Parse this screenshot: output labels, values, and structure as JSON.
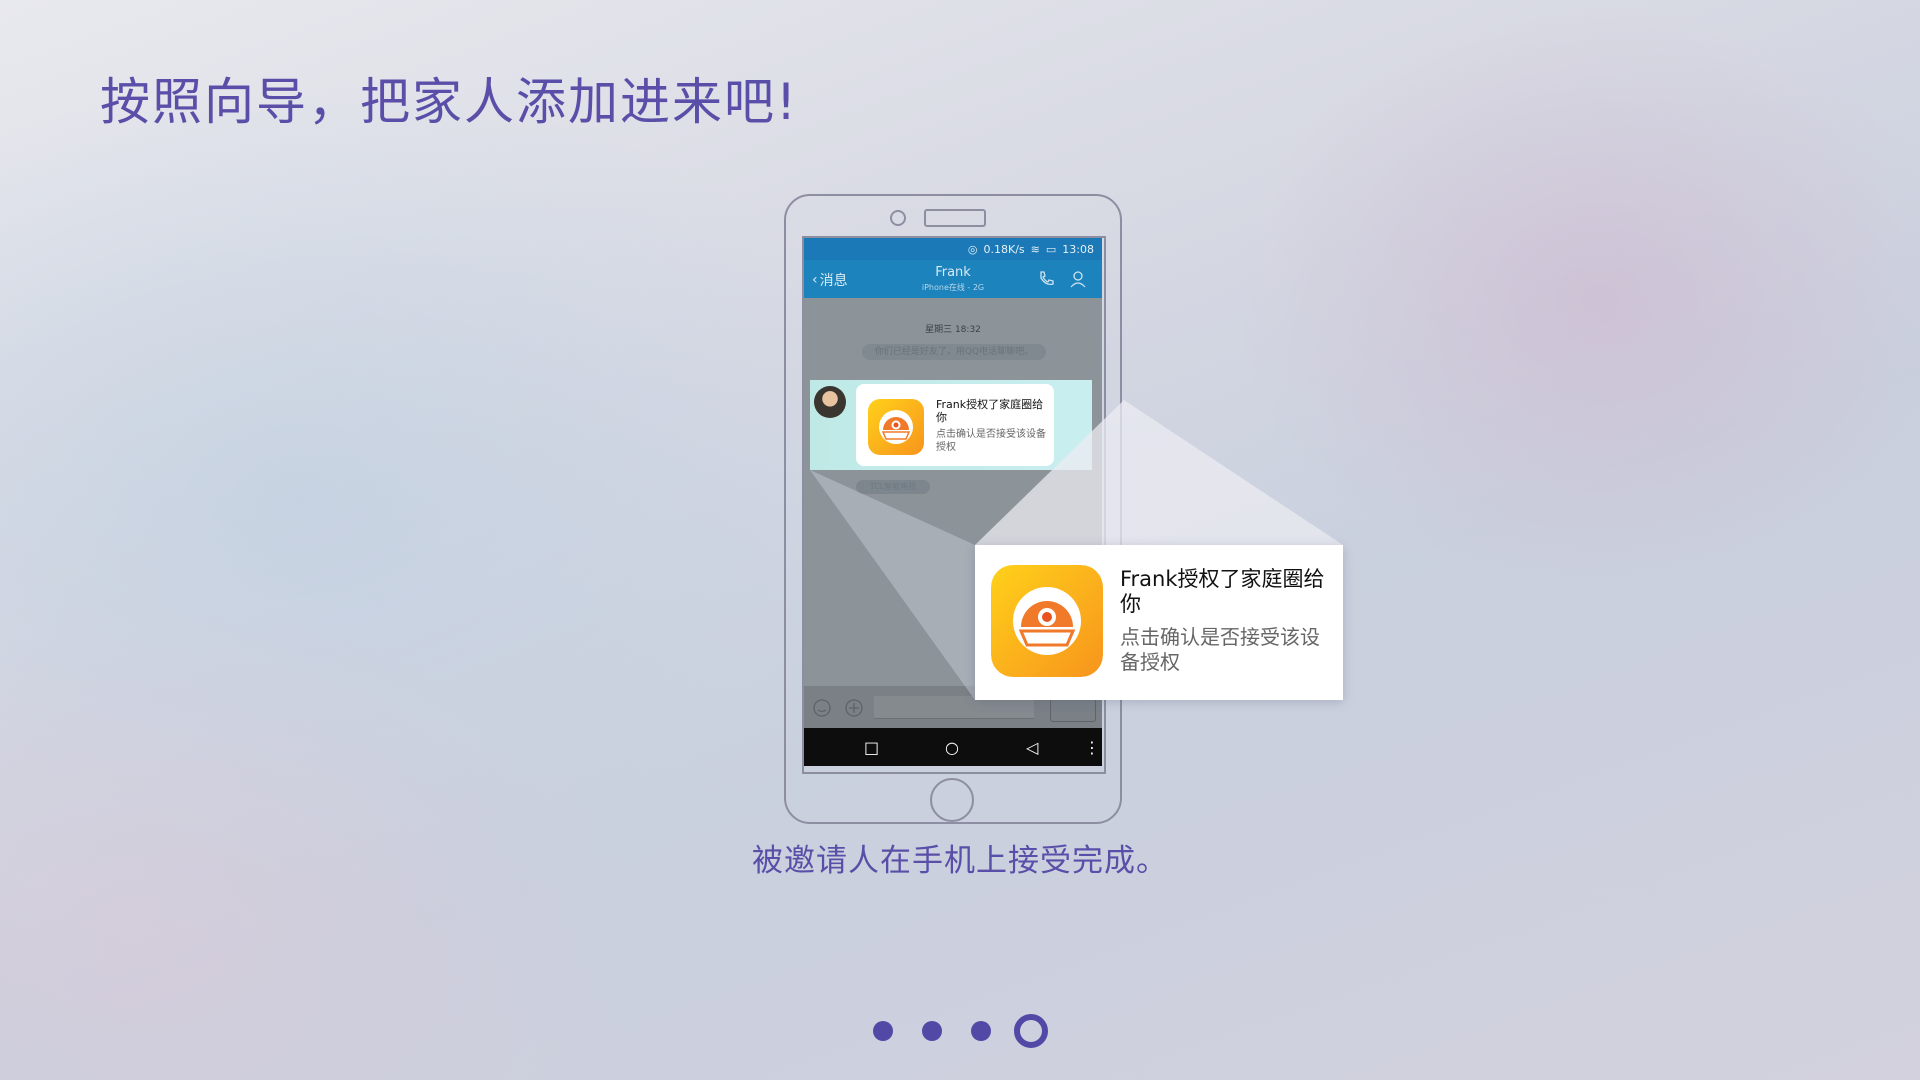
{
  "page": {
    "title": "按照向导，把家人添加进来吧!",
    "caption": "被邀请人在手机上接受完成。"
  },
  "phone": {
    "status_bar": {
      "speed": "0.18K/s",
      "time": "13:08"
    },
    "nav_bar": {
      "back_label": "消息",
      "contact_name": "Frank",
      "contact_status": "iPhone在线 - 2G"
    },
    "chat": {
      "timestamp": "星期三 18:32",
      "system_message": "你们已经是好友了，用QQ电话聊聊吧。",
      "source_label": "TCL智能电视"
    }
  },
  "message_card": {
    "title": "Frank授权了家庭圈给你",
    "subtitle": "点击确认是否接受该设备授权"
  },
  "pager": {
    "count": 4,
    "active_index": 3
  },
  "colors": {
    "accent": "#5a4fa8",
    "qq_blue": "#1c83bd",
    "app_icon_orange": "#f7941d",
    "app_icon_yellow": "#ffc61a"
  }
}
